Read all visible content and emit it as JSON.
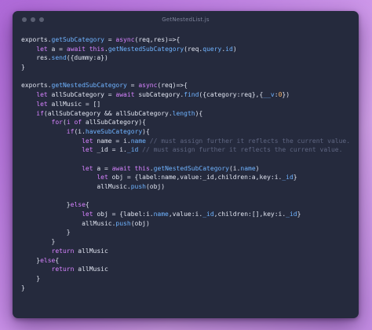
{
  "window": {
    "title": "GetNestedList.js",
    "controls": [
      "close",
      "minimize",
      "maximize"
    ]
  },
  "colors": {
    "background": "#252a3d",
    "keyword": "#d783ff",
    "function": "#6fb3ff",
    "number": "#f5b36b",
    "comment": "#5f6682",
    "text": "#dfe3ef"
  },
  "code_lines": [
    [
      [
        "pl",
        "exports."
      ],
      [
        "fn",
        "getSubCategory"
      ],
      [
        "pl",
        " = "
      ],
      [
        "kw",
        "async"
      ],
      [
        "pl",
        "(req,res)=>{"
      ]
    ],
    [
      [
        "pl",
        "    "
      ],
      [
        "kw",
        "let"
      ],
      [
        "pl",
        " a = "
      ],
      [
        "kw",
        "await"
      ],
      [
        "pl",
        " "
      ],
      [
        "kw",
        "this"
      ],
      [
        "pl",
        "."
      ],
      [
        "fn",
        "getNestedSubCategory"
      ],
      [
        "pl",
        "(req."
      ],
      [
        "prop",
        "query"
      ],
      [
        "pl",
        "."
      ],
      [
        "prop",
        "id"
      ],
      [
        "pl",
        ")"
      ]
    ],
    [
      [
        "pl",
        "    res."
      ],
      [
        "fn",
        "send"
      ],
      [
        "pl",
        "({dummy:a})"
      ]
    ],
    [
      [
        "pl",
        "}"
      ]
    ],
    [
      [
        "pl",
        ""
      ]
    ],
    [
      [
        "pl",
        "exports."
      ],
      [
        "fn",
        "getNestedSubCategory"
      ],
      [
        "pl",
        " = "
      ],
      [
        "kw",
        "async"
      ],
      [
        "pl",
        "(req)=>{"
      ]
    ],
    [
      [
        "pl",
        "    "
      ],
      [
        "kw",
        "let"
      ],
      [
        "pl",
        " allSubCategory = "
      ],
      [
        "kw",
        "await"
      ],
      [
        "pl",
        " subCategory."
      ],
      [
        "fn",
        "find"
      ],
      [
        "pl",
        "({category:req},{"
      ],
      [
        "prop",
        "__v"
      ],
      [
        "pl",
        ":"
      ],
      [
        "num",
        "0"
      ],
      [
        "pl",
        "})"
      ]
    ],
    [
      [
        "pl",
        "    "
      ],
      [
        "kw",
        "let"
      ],
      [
        "pl",
        " allMusic = []"
      ]
    ],
    [
      [
        "pl",
        "    "
      ],
      [
        "kw",
        "if"
      ],
      [
        "pl",
        "(allSubCategory && allSubCategory."
      ],
      [
        "prop",
        "length"
      ],
      [
        "pl",
        ")"
      ],
      [
        "pl",
        "{"
      ]
    ],
    [
      [
        "pl",
        "        "
      ],
      [
        "kw",
        "for"
      ],
      [
        "pl",
        "("
      ],
      [
        "kw",
        "i"
      ],
      [
        "pl",
        " "
      ],
      [
        "kw",
        "of"
      ],
      [
        "pl",
        " allSubCategory){"
      ]
    ],
    [
      [
        "pl",
        "            "
      ],
      [
        "kw",
        "if"
      ],
      [
        "pl",
        "(i."
      ],
      [
        "prop",
        "haveSubCategory"
      ],
      [
        "pl",
        "){"
      ]
    ],
    [
      [
        "pl",
        "                "
      ],
      [
        "kw",
        "let"
      ],
      [
        "pl",
        " name = i."
      ],
      [
        "prop",
        "name"
      ],
      [
        "pl",
        " "
      ],
      [
        "cm",
        "// must assign further it reflects the current value."
      ]
    ],
    [
      [
        "pl",
        "                "
      ],
      [
        "kw",
        "let"
      ],
      [
        "pl",
        " _id = i."
      ],
      [
        "prop",
        "_id"
      ],
      [
        "pl",
        " "
      ],
      [
        "cm",
        "// must assign further it reflects the current value."
      ]
    ],
    [
      [
        "pl",
        ""
      ]
    ],
    [
      [
        "pl",
        "                "
      ],
      [
        "kw",
        "let"
      ],
      [
        "pl",
        " a = "
      ],
      [
        "kw",
        "await"
      ],
      [
        "pl",
        " "
      ],
      [
        "kw",
        "this"
      ],
      [
        "pl",
        "."
      ],
      [
        "fn",
        "getNestedSubCategory"
      ],
      [
        "pl",
        "(i."
      ],
      [
        "prop",
        "name"
      ],
      [
        "pl",
        ")"
      ]
    ],
    [
      [
        "pl",
        "                    "
      ],
      [
        "kw",
        "let"
      ],
      [
        "pl",
        " obj = {label:name,value:_id,children:a,key:i."
      ],
      [
        "prop",
        "_id"
      ],
      [
        "pl",
        "}"
      ]
    ],
    [
      [
        "pl",
        "                    allMusic."
      ],
      [
        "fn",
        "push"
      ],
      [
        "pl",
        "(obj)"
      ]
    ],
    [
      [
        "pl",
        ""
      ]
    ],
    [
      [
        "pl",
        "            }"
      ],
      [
        "kw",
        "else"
      ],
      [
        "pl",
        "{"
      ]
    ],
    [
      [
        "pl",
        "                "
      ],
      [
        "kw",
        "let"
      ],
      [
        "pl",
        " obj = {label:i."
      ],
      [
        "prop",
        "name"
      ],
      [
        "pl",
        ",value:i."
      ],
      [
        "prop",
        "_id"
      ],
      [
        "pl",
        ",children:[],key:i."
      ],
      [
        "prop",
        "_id"
      ],
      [
        "pl",
        "}"
      ]
    ],
    [
      [
        "pl",
        "                allMusic."
      ],
      [
        "fn",
        "push"
      ],
      [
        "pl",
        "(obj)"
      ]
    ],
    [
      [
        "pl",
        "            }"
      ]
    ],
    [
      [
        "pl",
        "        }"
      ]
    ],
    [
      [
        "pl",
        "        "
      ],
      [
        "kw",
        "return"
      ],
      [
        "pl",
        " allMusic"
      ]
    ],
    [
      [
        "pl",
        "    }"
      ],
      [
        "kw",
        "else"
      ],
      [
        "pl",
        "{"
      ]
    ],
    [
      [
        "pl",
        "        "
      ],
      [
        "kw",
        "return"
      ],
      [
        "pl",
        " allMusic"
      ]
    ],
    [
      [
        "pl",
        "    }"
      ]
    ],
    [
      [
        "pl",
        "}"
      ]
    ]
  ]
}
